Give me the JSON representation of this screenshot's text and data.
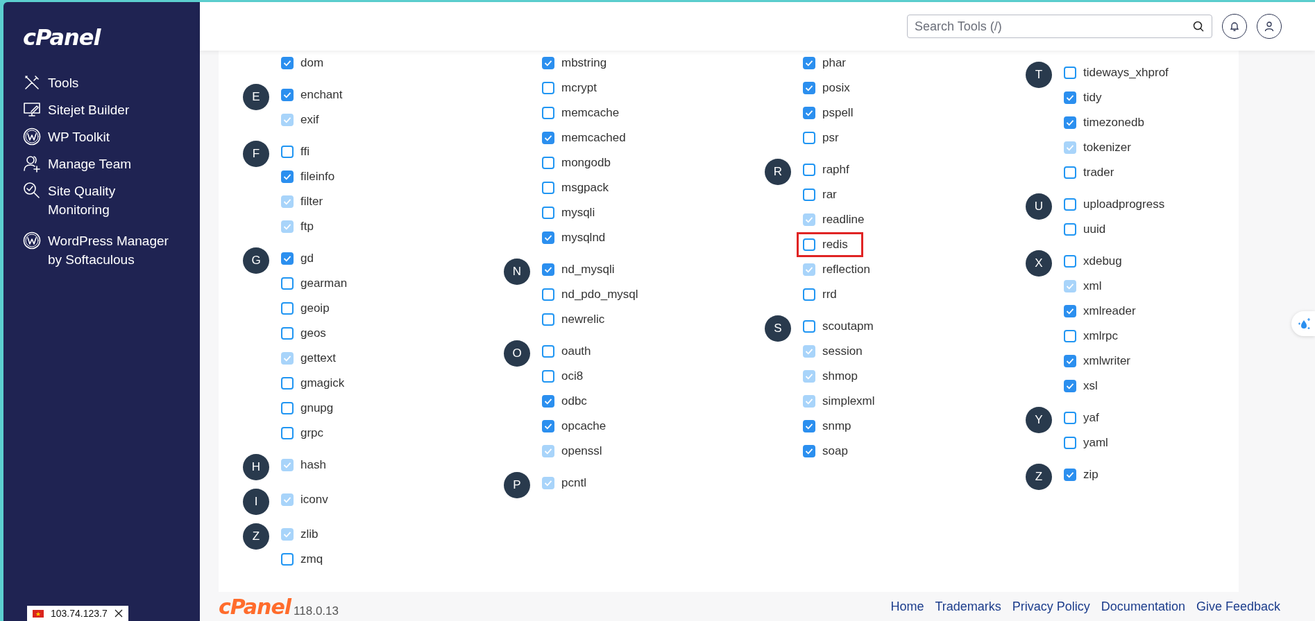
{
  "sidebar": {
    "logo": "cPanel",
    "items": [
      {
        "label": "Tools"
      },
      {
        "label": "Sitejet Builder"
      },
      {
        "label": "WP Toolkit"
      },
      {
        "label": "Manage Team"
      },
      {
        "label": "Site Quality Monitoring"
      },
      {
        "label": "WordPress Manager by Softaculous"
      }
    ],
    "ip_badge": {
      "text": "103.74.123.7"
    }
  },
  "header": {
    "search": {
      "placeholder": "Search Tools (/)"
    }
  },
  "columns": [
    {
      "groups": [
        {
          "items": [
            {
              "label": "dom",
              "checked": true,
              "disabled": false,
              "highlighted": false
            }
          ]
        },
        {
          "letter": "E",
          "items": [
            {
              "label": "enchant",
              "checked": true,
              "disabled": false,
              "highlighted": false
            },
            {
              "label": "exif",
              "checked": true,
              "disabled": true,
              "highlighted": false
            }
          ]
        },
        {
          "letter": "F",
          "items": [
            {
              "label": "ffi",
              "checked": false,
              "disabled": false,
              "highlighted": false
            },
            {
              "label": "fileinfo",
              "checked": true,
              "disabled": false,
              "highlighted": false
            },
            {
              "label": "filter",
              "checked": true,
              "disabled": true,
              "highlighted": false
            },
            {
              "label": "ftp",
              "checked": true,
              "disabled": true,
              "highlighted": false
            }
          ]
        },
        {
          "letter": "G",
          "items": [
            {
              "label": "gd",
              "checked": true,
              "disabled": false,
              "highlighted": false
            },
            {
              "label": "gearman",
              "checked": false,
              "disabled": false,
              "highlighted": false
            },
            {
              "label": "geoip",
              "checked": false,
              "disabled": false,
              "highlighted": false
            },
            {
              "label": "geos",
              "checked": false,
              "disabled": false,
              "highlighted": false
            },
            {
              "label": "gettext",
              "checked": true,
              "disabled": true,
              "highlighted": false
            },
            {
              "label": "gmagick",
              "checked": false,
              "disabled": false,
              "highlighted": false
            },
            {
              "label": "gnupg",
              "checked": false,
              "disabled": false,
              "highlighted": false
            },
            {
              "label": "grpc",
              "checked": false,
              "disabled": false,
              "highlighted": false
            }
          ]
        },
        {
          "letter": "H",
          "items": [
            {
              "label": "hash",
              "checked": true,
              "disabled": true,
              "highlighted": false
            }
          ]
        },
        {
          "letter": "I",
          "items": [
            {
              "label": "iconv",
              "checked": true,
              "disabled": true,
              "highlighted": false
            }
          ]
        },
        {
          "letter": "Z",
          "items": [
            {
              "label": "zlib",
              "checked": true,
              "disabled": true,
              "highlighted": false
            },
            {
              "label": "zmq",
              "checked": false,
              "disabled": false,
              "highlighted": false
            }
          ]
        }
      ]
    },
    {
      "groups": [
        {
          "items": [
            {
              "label": "mbstring",
              "checked": true,
              "disabled": false,
              "highlighted": false
            },
            {
              "label": "mcrypt",
              "checked": false,
              "disabled": false,
              "highlighted": false
            },
            {
              "label": "memcache",
              "checked": false,
              "disabled": false,
              "highlighted": false
            },
            {
              "label": "memcached",
              "checked": true,
              "disabled": false,
              "highlighted": false
            },
            {
              "label": "mongodb",
              "checked": false,
              "disabled": false,
              "highlighted": false
            },
            {
              "label": "msgpack",
              "checked": false,
              "disabled": false,
              "highlighted": false
            },
            {
              "label": "mysqli",
              "checked": false,
              "disabled": false,
              "highlighted": false
            },
            {
              "label": "mysqlnd",
              "checked": true,
              "disabled": false,
              "highlighted": false
            }
          ]
        },
        {
          "letter": "N",
          "items": [
            {
              "label": "nd_mysqli",
              "checked": true,
              "disabled": false,
              "highlighted": false
            },
            {
              "label": "nd_pdo_mysql",
              "checked": false,
              "disabled": false,
              "highlighted": false
            },
            {
              "label": "newrelic",
              "checked": false,
              "disabled": false,
              "highlighted": false
            }
          ]
        },
        {
          "letter": "O",
          "items": [
            {
              "label": "oauth",
              "checked": false,
              "disabled": false,
              "highlighted": false
            },
            {
              "label": "oci8",
              "checked": false,
              "disabled": false,
              "highlighted": false
            },
            {
              "label": "odbc",
              "checked": true,
              "disabled": false,
              "highlighted": false
            },
            {
              "label": "opcache",
              "checked": true,
              "disabled": false,
              "highlighted": false
            },
            {
              "label": "openssl",
              "checked": true,
              "disabled": true,
              "highlighted": false
            }
          ]
        },
        {
          "letter": "P",
          "items": [
            {
              "label": "pcntl",
              "checked": true,
              "disabled": true,
              "highlighted": false
            }
          ]
        }
      ]
    },
    {
      "groups": [
        {
          "items": [
            {
              "label": "phar",
              "checked": true,
              "disabled": false,
              "highlighted": false
            },
            {
              "label": "posix",
              "checked": true,
              "disabled": false,
              "highlighted": false
            },
            {
              "label": "pspell",
              "checked": true,
              "disabled": false,
              "highlighted": false
            },
            {
              "label": "psr",
              "checked": false,
              "disabled": false,
              "highlighted": false
            }
          ]
        },
        {
          "letter": "R",
          "items": [
            {
              "label": "raphf",
              "checked": false,
              "disabled": false,
              "highlighted": false
            },
            {
              "label": "rar",
              "checked": false,
              "disabled": false,
              "highlighted": false
            },
            {
              "label": "readline",
              "checked": true,
              "disabled": true,
              "highlighted": false
            },
            {
              "label": "redis",
              "checked": false,
              "disabled": false,
              "highlighted": true
            },
            {
              "label": "reflection",
              "checked": true,
              "disabled": true,
              "highlighted": false
            },
            {
              "label": "rrd",
              "checked": false,
              "disabled": false,
              "highlighted": false
            }
          ]
        },
        {
          "letter": "S",
          "items": [
            {
              "label": "scoutapm",
              "checked": false,
              "disabled": false,
              "highlighted": false
            },
            {
              "label": "session",
              "checked": true,
              "disabled": true,
              "highlighted": false
            },
            {
              "label": "shmop",
              "checked": true,
              "disabled": true,
              "highlighted": false
            },
            {
              "label": "simplexml",
              "checked": true,
              "disabled": true,
              "highlighted": false
            },
            {
              "label": "snmp",
              "checked": true,
              "disabled": false,
              "highlighted": false
            },
            {
              "label": "soap",
              "checked": true,
              "disabled": false,
              "highlighted": false
            }
          ]
        }
      ]
    },
    {
      "groups": [
        {
          "letter": "T",
          "items": [
            {
              "label": "tideways_xhprof",
              "checked": false,
              "disabled": false,
              "highlighted": false
            },
            {
              "label": "tidy",
              "checked": true,
              "disabled": false,
              "highlighted": false
            },
            {
              "label": "timezonedb",
              "checked": true,
              "disabled": false,
              "highlighted": false
            },
            {
              "label": "tokenizer",
              "checked": true,
              "disabled": true,
              "highlighted": false
            },
            {
              "label": "trader",
              "checked": false,
              "disabled": false,
              "highlighted": false
            }
          ]
        },
        {
          "letter": "U",
          "items": [
            {
              "label": "uploadprogress",
              "checked": false,
              "disabled": false,
              "highlighted": false
            },
            {
              "label": "uuid",
              "checked": false,
              "disabled": false,
              "highlighted": false
            }
          ]
        },
        {
          "letter": "X",
          "items": [
            {
              "label": "xdebug",
              "checked": false,
              "disabled": false,
              "highlighted": false
            },
            {
              "label": "xml",
              "checked": true,
              "disabled": true,
              "highlighted": false
            },
            {
              "label": "xmlreader",
              "checked": true,
              "disabled": false,
              "highlighted": false
            },
            {
              "label": "xmlrpc",
              "checked": false,
              "disabled": false,
              "highlighted": false
            },
            {
              "label": "xmlwriter",
              "checked": true,
              "disabled": false,
              "highlighted": false
            },
            {
              "label": "xsl",
              "checked": true,
              "disabled": false,
              "highlighted": false
            }
          ]
        },
        {
          "letter": "Y",
          "items": [
            {
              "label": "yaf",
              "checked": false,
              "disabled": false,
              "highlighted": false
            },
            {
              "label": "yaml",
              "checked": false,
              "disabled": false,
              "highlighted": false
            }
          ]
        },
        {
          "letter": "Z",
          "items": [
            {
              "label": "zip",
              "checked": true,
              "disabled": false,
              "highlighted": false
            }
          ]
        }
      ]
    }
  ],
  "footer": {
    "logo": "cPanel",
    "version": "118.0.13",
    "links": [
      "Home",
      "Trademarks",
      "Privacy Policy",
      "Documentation",
      "Give Feedback"
    ]
  }
}
